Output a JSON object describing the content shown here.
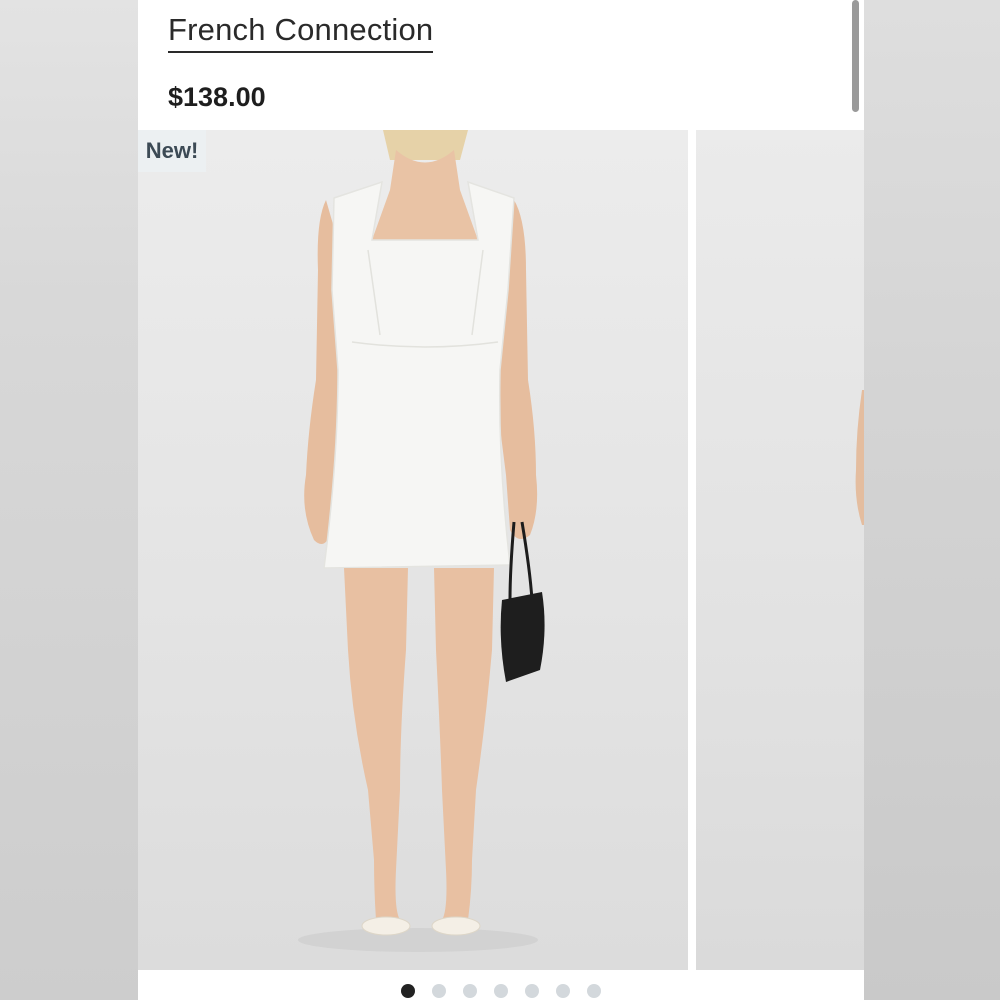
{
  "product": {
    "brand": "French Connection",
    "price": "$138.00"
  },
  "gallery": {
    "badge": "New!",
    "current_index": 1,
    "image_count": 7,
    "images": [
      {
        "subject": "model-front-white-mini-dress"
      },
      {
        "subject": "model-partial-next-image"
      }
    ]
  },
  "colors": {
    "text_primary": "#2a2a2a",
    "badge_bg": "#ecf0f2",
    "badge_text": "#3c4a55",
    "dot_active": "#222222",
    "dot_inactive": "#d3d8dc"
  }
}
